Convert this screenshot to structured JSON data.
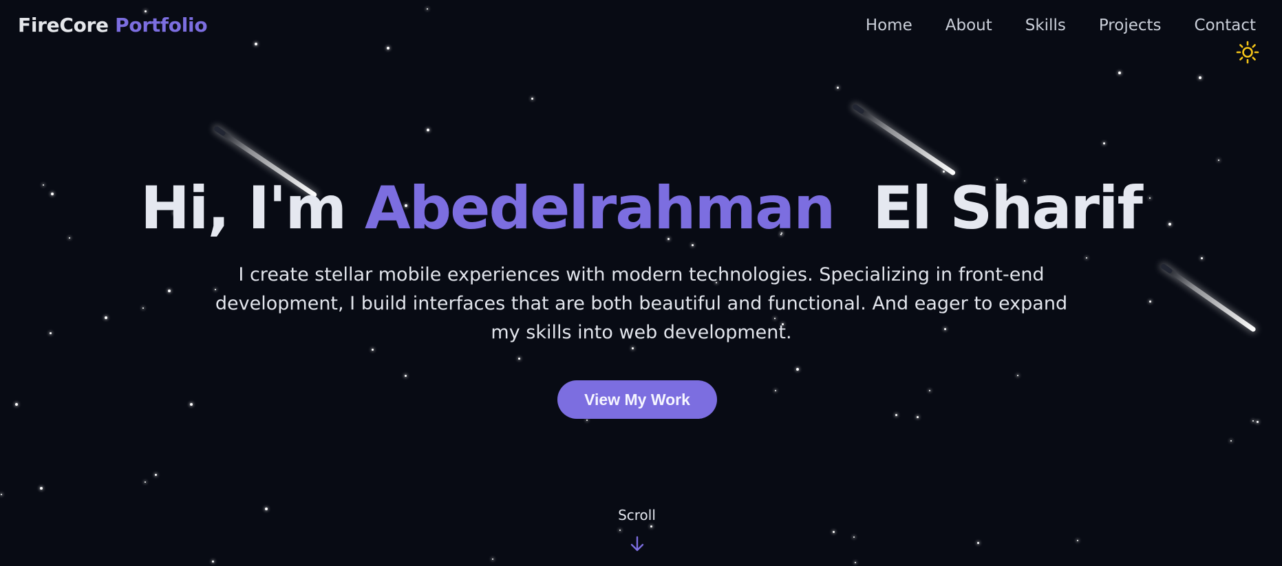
{
  "header": {
    "brand_primary": "FireCore",
    "brand_accent": "Portfolio",
    "nav": [
      {
        "label": "Home"
      },
      {
        "label": "About"
      },
      {
        "label": "Skills"
      },
      {
        "label": "Projects"
      },
      {
        "label": "Contact"
      }
    ],
    "theme_icon": "sun-icon",
    "theme_icon_color": "#f5c518"
  },
  "hero": {
    "greeting": "Hi, I'm",
    "first_name": "Abedelrahman",
    "last_name": "El Sharif",
    "subtitle": "I create stellar mobile experiences with modern technologies. Specializing in front-end development, I build interfaces that are both beautiful and functional. And eager to expand my skills into web development.",
    "cta_label": "View My Work"
  },
  "scroll": {
    "label": "Scroll",
    "icon": "arrow-down-icon"
  },
  "colors": {
    "background": "#080b14",
    "accent": "#7c6ee0",
    "text": "#e5e8f0",
    "sun": "#f5c518"
  }
}
